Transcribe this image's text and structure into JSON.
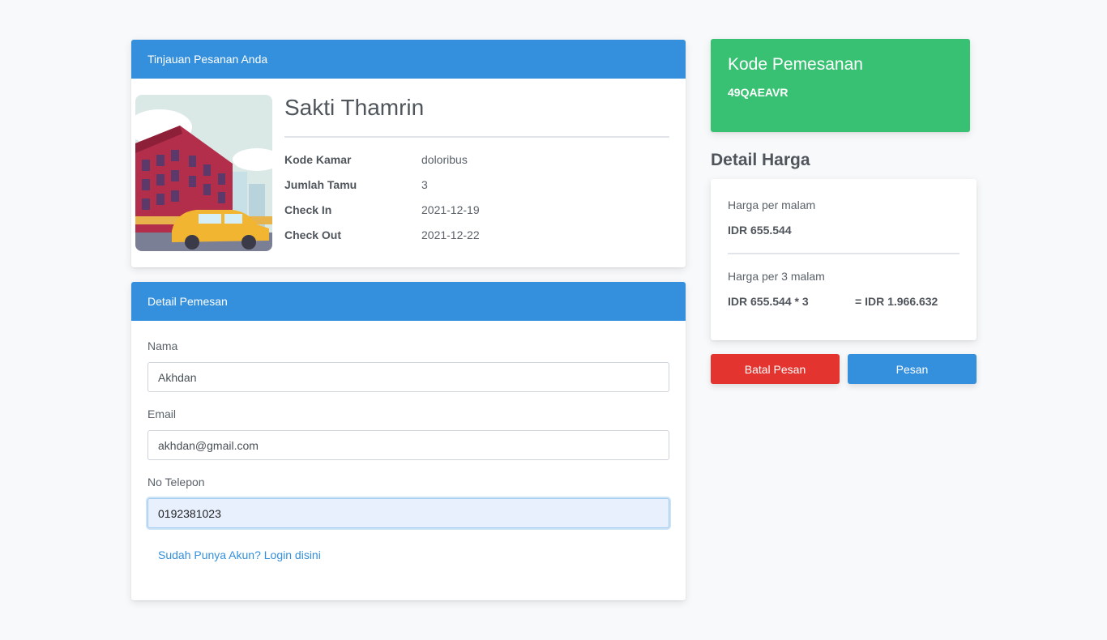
{
  "review": {
    "header": "Tinjauan Pesanan Anda",
    "guest_name": "Sakti Thamrin",
    "rows": [
      {
        "label": "Kode Kamar",
        "value": "doloribus"
      },
      {
        "label": "Jumlah Tamu",
        "value": "3"
      },
      {
        "label": "Check In",
        "value": "2021-12-19"
      },
      {
        "label": "Check Out",
        "value": "2021-12-22"
      }
    ]
  },
  "pemesan": {
    "header": "Detail Pemesan",
    "fields": [
      {
        "label": "Nama",
        "value": "Akhdan"
      },
      {
        "label": "Email",
        "value": "akhdan@gmail.com"
      },
      {
        "label": "No Telepon",
        "value": "0192381023"
      }
    ],
    "login_link": "Sudah Punya Akun? Login disini"
  },
  "kode": {
    "title": "Kode Pemesanan",
    "value": "49QAEAVR"
  },
  "harga": {
    "title": "Detail Harga",
    "per_night_label": "Harga per malam",
    "per_night_value": "IDR 655.544",
    "total_label": "Harga per 3 malam",
    "total_formula": "IDR 655.544 * 3",
    "total_value": "= IDR 1.966.632"
  },
  "actions": {
    "cancel": "Batal Pesan",
    "order": "Pesan"
  },
  "colors": {
    "primary": "#3490dc",
    "success": "#38c172",
    "danger": "#e3342f"
  }
}
